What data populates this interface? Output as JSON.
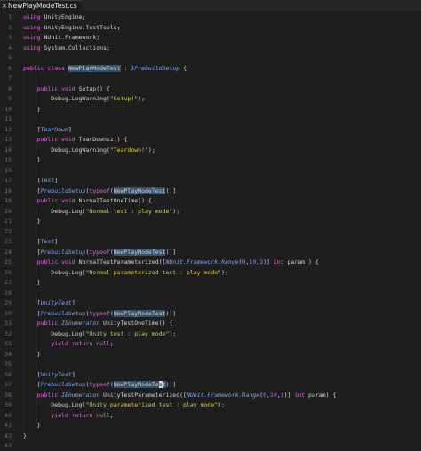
{
  "tab": {
    "filename": "NewPlayModeTest.cs",
    "close_glyph": "×"
  },
  "colors": {
    "background": "#1e1e1e",
    "keyword": "#e06cde",
    "type": "#a8e05b",
    "string": "#d9ce53",
    "number": "#ab7fe6",
    "attribute": "#7fa8f0",
    "highlight": "#36506b"
  },
  "code_lines": [
    [
      [
        "using",
        "kw"
      ],
      [
        " UnityEngine;",
        ""
      ]
    ],
    [
      [
        "using",
        "kw"
      ],
      [
        " UnityEngine.TestTools;",
        ""
      ]
    ],
    [
      [
        "using",
        "kw"
      ],
      [
        " NUnit.Framework;",
        ""
      ]
    ],
    [
      [
        "using",
        "kw"
      ],
      [
        " System.Collections;",
        ""
      ]
    ],
    [],
    [
      [
        "public",
        "kw"
      ],
      [
        " ",
        ""
      ],
      [
        "class",
        "kw"
      ],
      [
        " ",
        ""
      ],
      [
        "NewPlayModeTest",
        "hl"
      ],
      [
        " : ",
        ""
      ],
      [
        "IPrebuildSetup",
        "at"
      ],
      [
        " {",
        ""
      ]
    ],
    [],
    [
      [
        "    ",
        ""
      ],
      [
        "public",
        "kw"
      ],
      [
        " ",
        ""
      ],
      [
        "void",
        "kw"
      ],
      [
        " Setup() {",
        ""
      ]
    ],
    [
      [
        "        Debug.",
        ""
      ],
      [
        "LogWarning",
        "fn"
      ],
      [
        "(",
        ""
      ],
      [
        "\"Setup!\"",
        "st"
      ],
      [
        ");",
        ""
      ]
    ],
    [
      [
        "    }",
        ""
      ]
    ],
    [],
    [
      [
        "    [",
        ""
      ],
      [
        "TearDown",
        "at"
      ],
      [
        "]",
        ""
      ]
    ],
    [
      [
        "    ",
        ""
      ],
      [
        "public",
        "kw"
      ],
      [
        " ",
        ""
      ],
      [
        "void",
        "kw"
      ],
      [
        " TearDownzz() {",
        ""
      ]
    ],
    [
      [
        "        Debug.",
        ""
      ],
      [
        "LogWarning",
        "fn"
      ],
      [
        "(",
        ""
      ],
      [
        "\"Teardown!\"",
        "st"
      ],
      [
        ");",
        ""
      ]
    ],
    [
      [
        "    }",
        ""
      ]
    ],
    [],
    [
      [
        "    [",
        ""
      ],
      [
        "Test",
        "at"
      ],
      [
        "]",
        ""
      ]
    ],
    [
      [
        "    [",
        ""
      ],
      [
        "PrebuildSetup",
        "at"
      ],
      [
        "(",
        ""
      ],
      [
        "typeof",
        "kw"
      ],
      [
        "(",
        ""
      ],
      [
        "NewPlayModeTest",
        "hl"
      ],
      [
        "))]",
        ""
      ]
    ],
    [
      [
        "    ",
        ""
      ],
      [
        "public",
        "kw"
      ],
      [
        " ",
        ""
      ],
      [
        "void",
        "kw"
      ],
      [
        " NormalTestOneTime() {",
        ""
      ]
    ],
    [
      [
        "        Debug.Log(",
        ""
      ],
      [
        "\"Normal test : play mode\"",
        "st"
      ],
      [
        ");",
        ""
      ]
    ],
    [
      [
        "    }",
        ""
      ]
    ],
    [],
    [
      [
        "    [",
        ""
      ],
      [
        "Test",
        "at"
      ],
      [
        "]",
        ""
      ]
    ],
    [
      [
        "    [",
        ""
      ],
      [
        "PrebuildSetup",
        "at"
      ],
      [
        "(",
        ""
      ],
      [
        "typeof",
        "kw"
      ],
      [
        "(",
        ""
      ],
      [
        "NewPlayModeTest",
        "hl"
      ],
      [
        "))]",
        ""
      ]
    ],
    [
      [
        "    ",
        ""
      ],
      [
        "public",
        "kw"
      ],
      [
        " ",
        ""
      ],
      [
        "void",
        "kw"
      ],
      [
        " NormalTestParameterized([",
        ""
      ],
      [
        "NUnit.Framework.Range",
        "at"
      ],
      [
        "(",
        ""
      ],
      [
        "0",
        "nm"
      ],
      [
        ",",
        ""
      ],
      [
        "10",
        "nm"
      ],
      [
        ",",
        ""
      ],
      [
        "3",
        "nm"
      ],
      [
        ")] ",
        ""
      ],
      [
        "int",
        "kw"
      ],
      [
        " param ) {",
        ""
      ]
    ],
    [
      [
        "        Debug.Log(",
        ""
      ],
      [
        "\"Normal parameterized test : play mode\"",
        "st"
      ],
      [
        ");",
        ""
      ]
    ],
    [
      [
        "    }",
        ""
      ]
    ],
    [],
    [
      [
        "    [",
        ""
      ],
      [
        "UnityTest",
        "at"
      ],
      [
        "]",
        ""
      ]
    ],
    [
      [
        "    [",
        ""
      ],
      [
        "PrebuildSetup",
        "at"
      ],
      [
        "(",
        ""
      ],
      [
        "typeof",
        "kw"
      ],
      [
        "(",
        ""
      ],
      [
        "NewPlayModeTest",
        "hl"
      ],
      [
        "))]",
        ""
      ]
    ],
    [
      [
        "    ",
        ""
      ],
      [
        "public",
        "kw"
      ],
      [
        " ",
        ""
      ],
      [
        "IEnumerator",
        "at"
      ],
      [
        " UnityTestOneTime() {",
        ""
      ]
    ],
    [
      [
        "        Debug.Log(",
        ""
      ],
      [
        "\"Unity test : play mode\"",
        "st"
      ],
      [
        ");",
        ""
      ]
    ],
    [
      [
        "        ",
        ""
      ],
      [
        "yield",
        "kw"
      ],
      [
        " ",
        ""
      ],
      [
        "return",
        "kw"
      ],
      [
        " ",
        ""
      ],
      [
        "null",
        "kw"
      ],
      [
        ";",
        ""
      ]
    ],
    [
      [
        "    }",
        ""
      ]
    ],
    [],
    [
      [
        "    [",
        ""
      ],
      [
        "UnityTest",
        "at"
      ],
      [
        "]",
        ""
      ]
    ],
    [
      [
        "    [",
        ""
      ],
      [
        "PrebuildSetup",
        "at"
      ],
      [
        "(",
        ""
      ],
      [
        "typeof",
        "kw"
      ],
      [
        "(",
        ""
      ],
      [
        "NewPlayModeTe",
        "hl"
      ],
      [
        "s",
        "cursor"
      ],
      [
        "t",
        "hl"
      ],
      [
        "))]",
        ""
      ]
    ],
    [
      [
        "    ",
        ""
      ],
      [
        "public",
        "kw"
      ],
      [
        " ",
        ""
      ],
      [
        "IEnumerator",
        "at"
      ],
      [
        " UnityTestParameterized([",
        ""
      ],
      [
        "NUnit.Framework.Range",
        "at"
      ],
      [
        "(",
        ""
      ],
      [
        "0",
        "nm"
      ],
      [
        ",",
        ""
      ],
      [
        "10",
        "nm"
      ],
      [
        ",",
        ""
      ],
      [
        "3",
        "nm"
      ],
      [
        ")] ",
        ""
      ],
      [
        "int",
        "kw"
      ],
      [
        " param) {",
        ""
      ]
    ],
    [
      [
        "        Debug.Log(",
        ""
      ],
      [
        "\"Unity parameterized test : play mode\"",
        "st"
      ],
      [
        ");",
        ""
      ]
    ],
    [
      [
        "        ",
        ""
      ],
      [
        "yield",
        "kw"
      ],
      [
        " ",
        ""
      ],
      [
        "return",
        "kw"
      ],
      [
        " ",
        ""
      ],
      [
        "null",
        "kw"
      ],
      [
        ";",
        ""
      ]
    ],
    [
      [
        "    }",
        ""
      ]
    ],
    [
      [
        "}",
        ""
      ]
    ],
    []
  ]
}
